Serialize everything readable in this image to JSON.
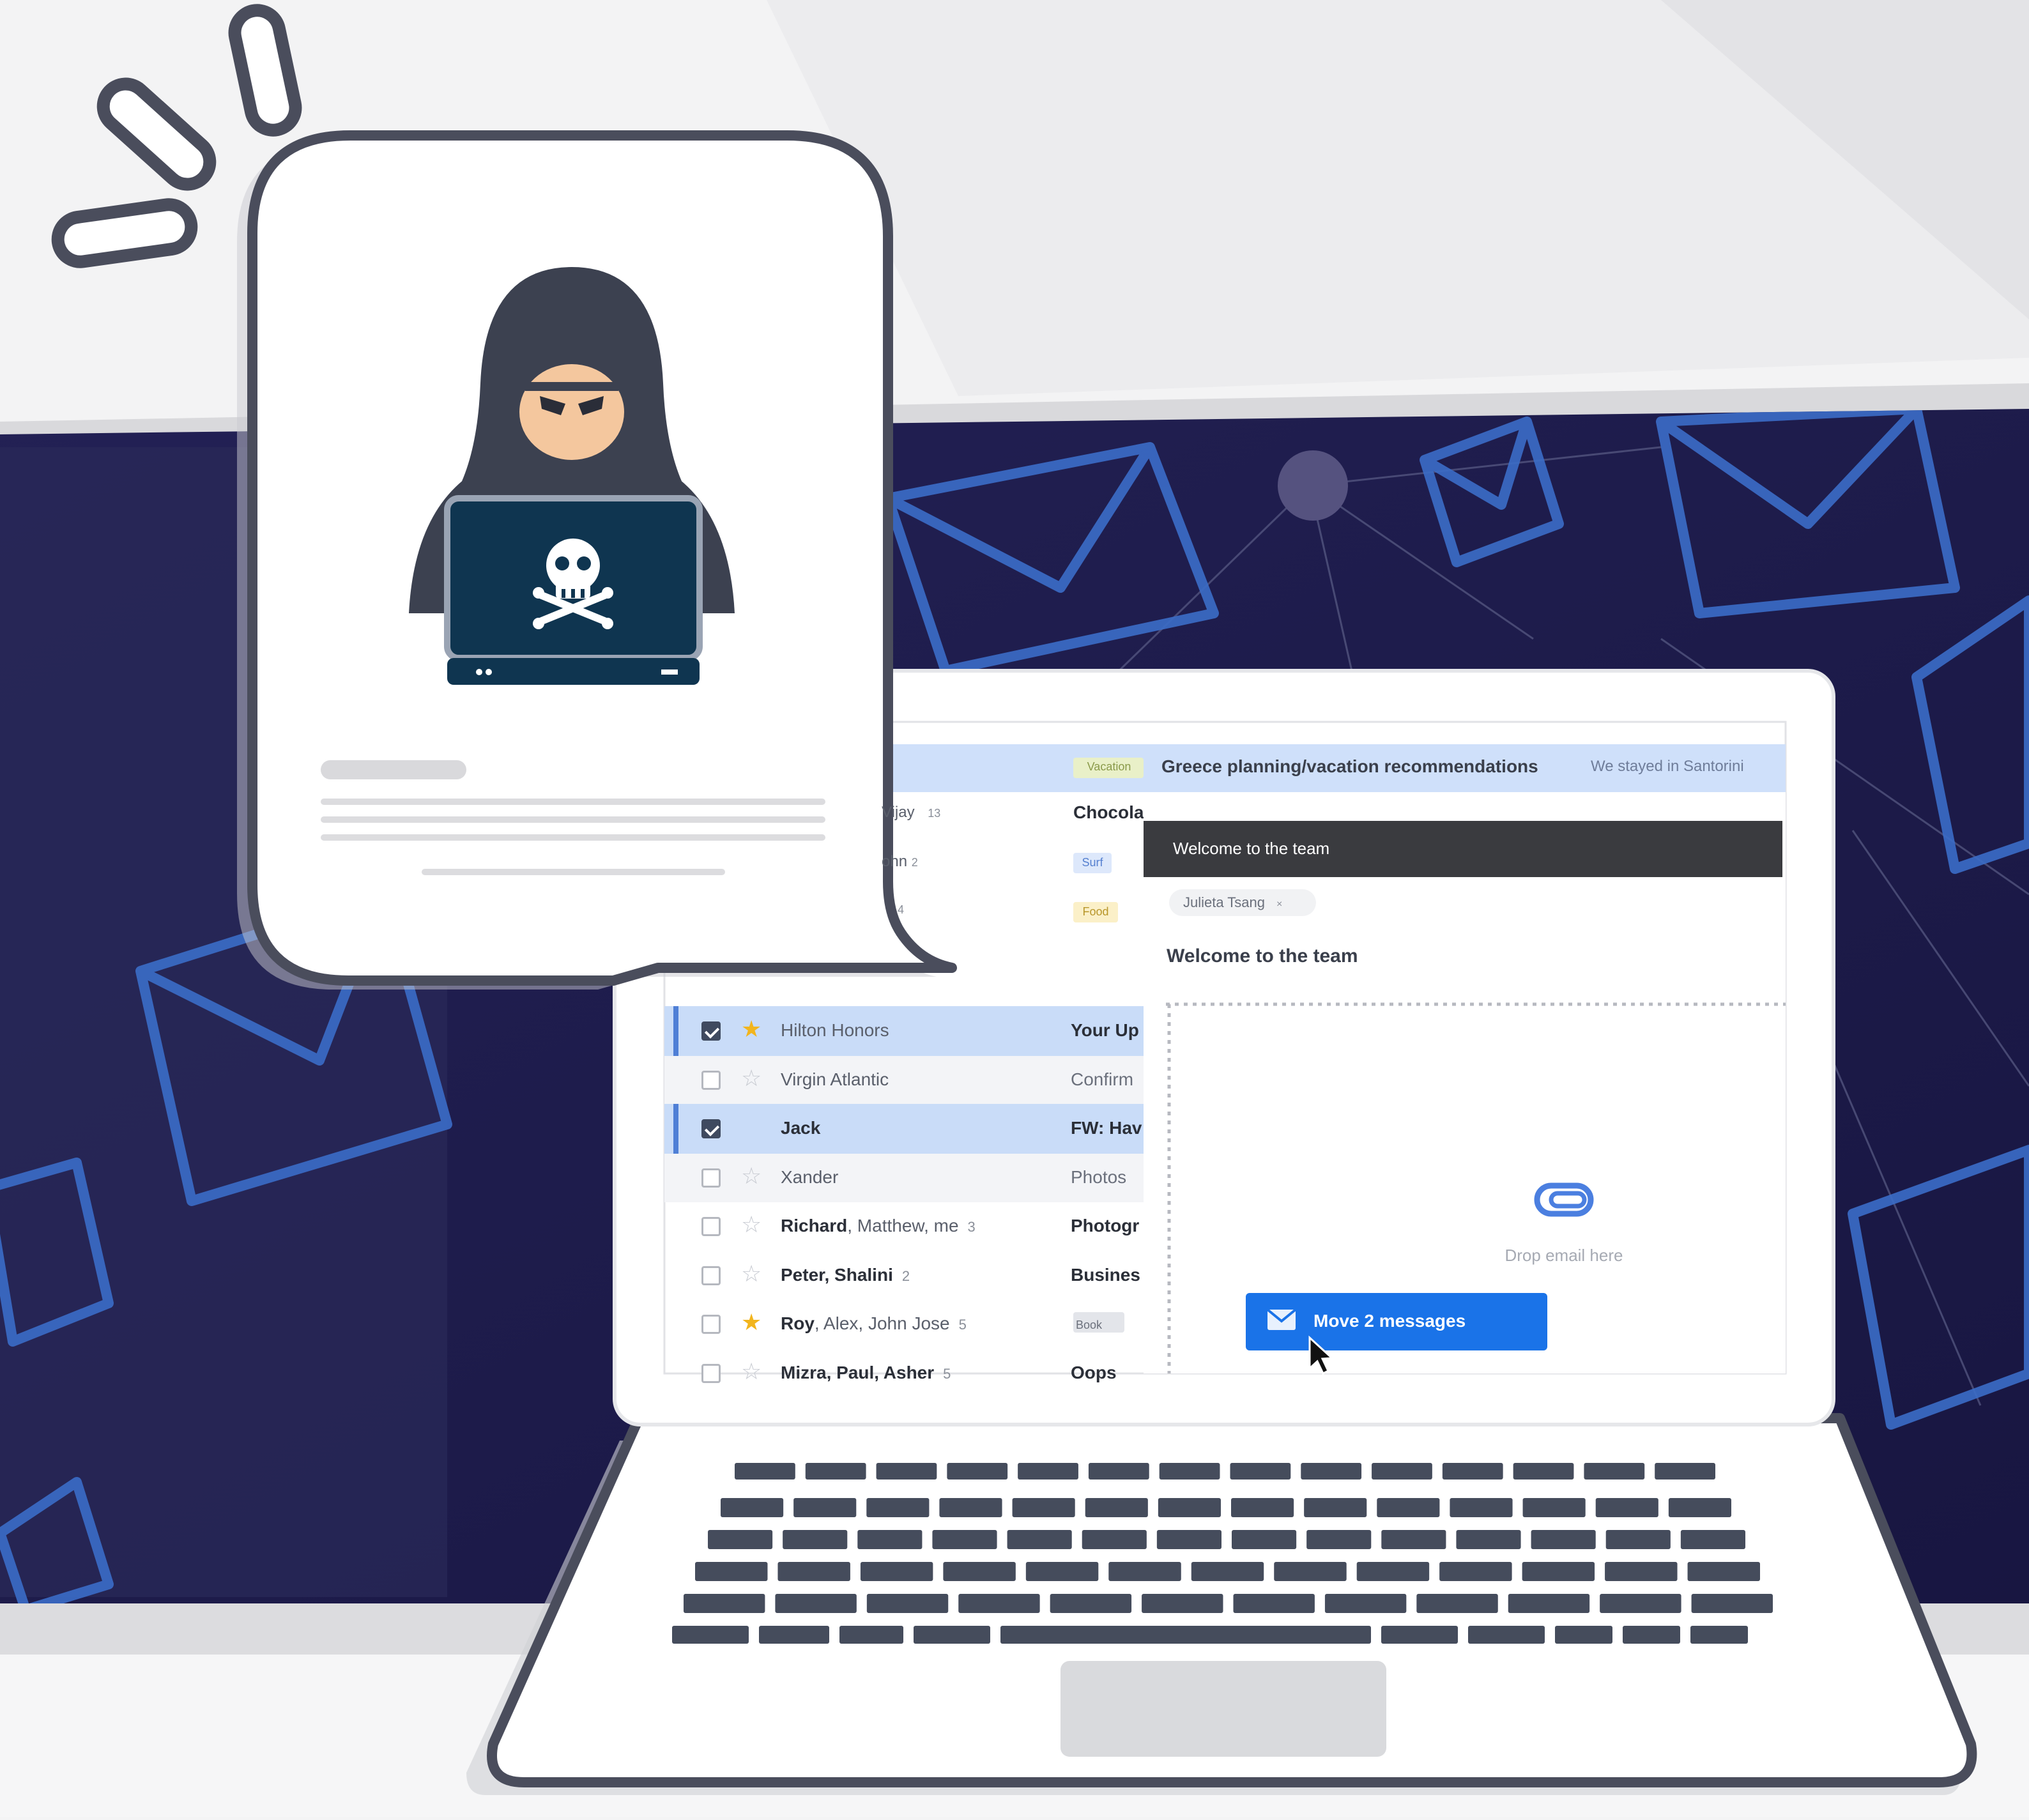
{
  "colors": {
    "navy": "#1f1d48",
    "laptop_outline": "#4a4d5c",
    "selected_row": "#c9dcf8",
    "accent_blue": "#1a73e8",
    "key_color": "#454c5c",
    "hacker_face": "#f4c79e",
    "hood": "#3c4150",
    "laptop_screen": "#0f3550"
  },
  "hacker_card": {
    "icon": "hacker-hoodie-icon",
    "laptop_icon": "skull-crossbones-icon"
  },
  "email_app": {
    "top_thread": {
      "tag": "Vacation",
      "subject": "Greece planning/vacation recommendations",
      "snippet": "We stayed in Santorini"
    },
    "partial_rows": [
      {
        "from": "Vijay",
        "count": "13",
        "subject": "Chocolate Factory Tour"
      },
      {
        "from": "ohn",
        "count": "2",
        "tag": "Surf"
      },
      {
        "from": "",
        "count": "4",
        "tag": "Food"
      }
    ],
    "rows": [
      {
        "from": "Hilton Honors",
        "subject": "Your Up",
        "checked": true,
        "star": "gold"
      },
      {
        "from": "Virgin Atlantic",
        "subject": "Confirm",
        "checked": false,
        "star": "empty"
      },
      {
        "from": "Jack",
        "subject": "FW: Hav",
        "checked": true,
        "star": "none"
      },
      {
        "from": "Xander",
        "subject": "Photos",
        "checked": false,
        "star": "empty"
      },
      {
        "from": "Richard",
        "from_rest": ", Matthew, me",
        "count": "3",
        "subject": "Photogr",
        "checked": false,
        "star": "empty"
      },
      {
        "from": "Peter, Shalini",
        "count": "2",
        "subject": "Busines",
        "checked": false,
        "star": "empty"
      },
      {
        "from": "Roy",
        "from_rest": ", Alex, John Jose",
        "count": "5",
        "subject": "Book",
        "checked": false,
        "star": "gold"
      },
      {
        "from": "Mizra, Paul, Asher",
        "count": "5",
        "subject": "Oops",
        "checked": false,
        "star": "empty"
      }
    ],
    "compose": {
      "header": "Welcome to the team",
      "to_chip": "Julieta Tsang",
      "subject": "Welcome to the team",
      "drop_text": "Drop email here",
      "move_button": "Move 2 messages",
      "drop_icon": "paperclip-icon",
      "move_icon": "envelope-move-icon"
    }
  }
}
